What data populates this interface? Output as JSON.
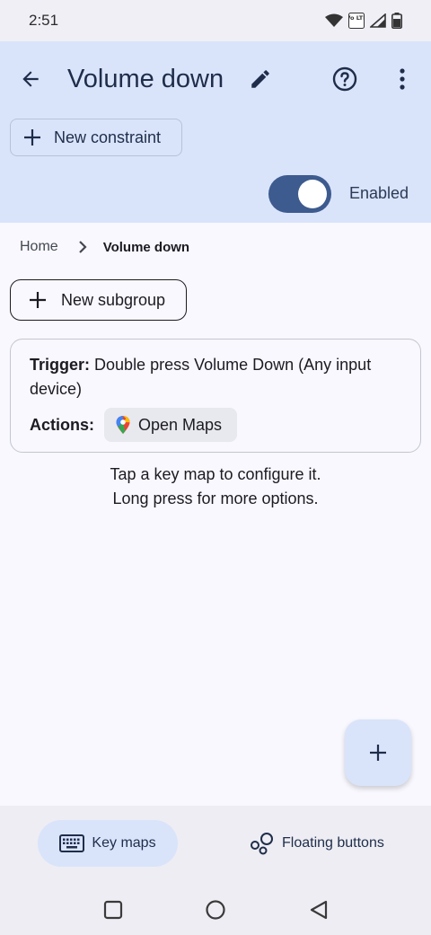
{
  "status_bar": {
    "time": "2:51",
    "volte_badge": "Vo LTE"
  },
  "header": {
    "title": "Volume down",
    "new_constraint_label": "New constraint",
    "toggle_label": "Enabled",
    "toggle_on": true
  },
  "breadcrumb": {
    "home": "Home",
    "current": "Volume down"
  },
  "subgroup": {
    "label": "New subgroup"
  },
  "keymap": {
    "trigger_label": "Trigger:",
    "trigger_value": "Double press Volume Down (Any input device)",
    "actions_label": "Actions:",
    "action_name": "Open Maps"
  },
  "hint": {
    "line1": "Tap a key map to configure it.",
    "line2": "Long press for more options."
  },
  "bottom_nav": {
    "key_maps": "Key maps",
    "floating_buttons": "Floating buttons"
  },
  "colors": {
    "header_bg": "#d9e4fb",
    "toggle_track": "#3d5b8e",
    "surface": "#f8f8fe",
    "nav_bg": "#ededf3"
  }
}
